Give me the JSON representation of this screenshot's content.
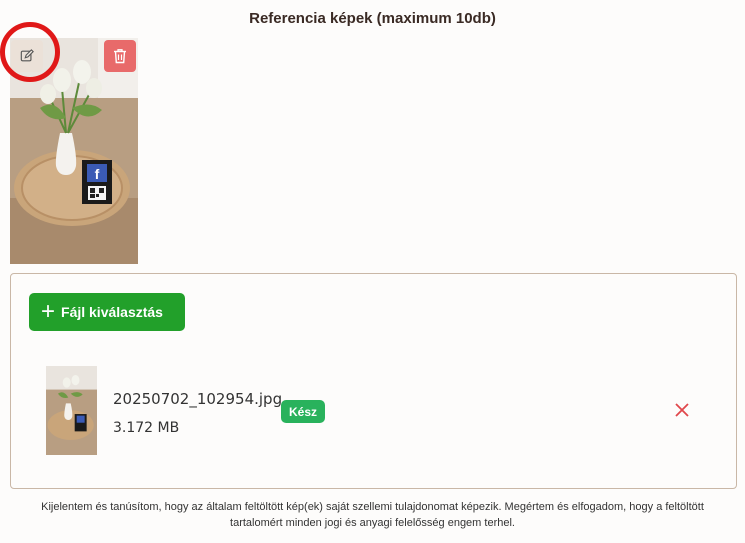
{
  "section": {
    "title": "Referencia képek (maximum 10db)"
  },
  "reference_image": {
    "edit_icon": "edit-icon",
    "delete_icon": "trash-icon"
  },
  "uploader": {
    "choose_label": "Fájl kiválasztás",
    "files": [
      {
        "name": "20250702_102954.jpg",
        "size": "3.172 MB",
        "status": "Kész"
      }
    ]
  },
  "colors": {
    "accent_green": "#22a02a",
    "status_green": "#29b25c",
    "danger": "#e86a6a"
  },
  "disclaimer": {
    "line1": "Kijelentem és tanúsítom, hogy az általam feltöltött kép(ek) saját szellemi tulajdonomat képezik. Megértem és elfogadom, hogy a feltöltött",
    "line2": "tartalomért minden jogi és anyagi felelősség engem terhel."
  }
}
